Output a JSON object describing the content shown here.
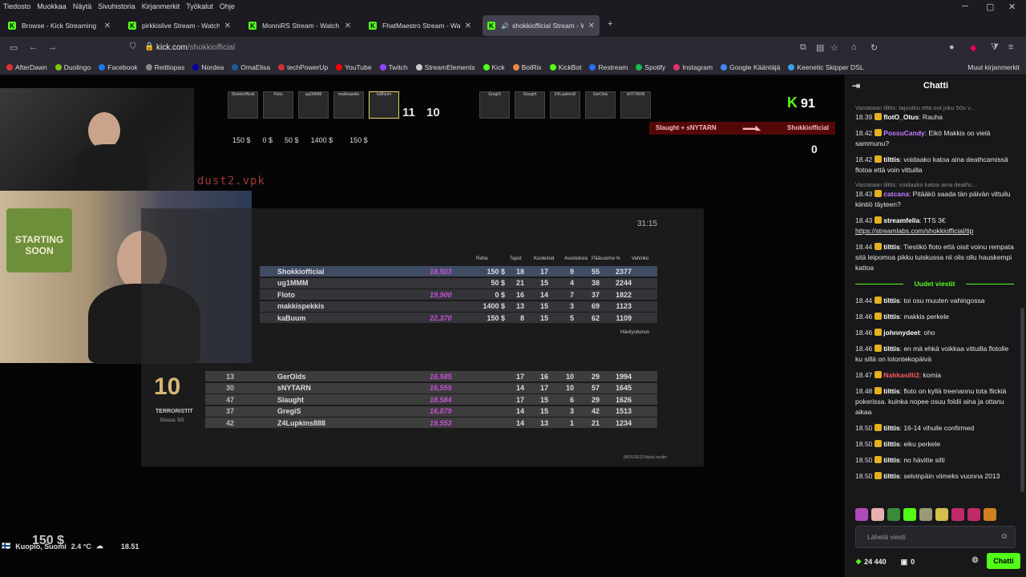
{
  "menu": [
    "Tiedosto",
    "Muokkaa",
    "Näytä",
    "Sivuhistoria",
    "Kirjanmerkit",
    "Työkalut",
    "Ohje"
  ],
  "tabs": [
    {
      "label": "Browse - Kick Streaming"
    },
    {
      "label": "pirkkislive Stream - Watch Li"
    },
    {
      "label": "MonniRS Stream - Watch Li"
    },
    {
      "label": "FhatMaestro Stream - Watch"
    },
    {
      "label": "shokkiofficial Stream - Watc"
    }
  ],
  "address": {
    "domain": "kick.com",
    "path": "/shokkiofficial"
  },
  "bookmarks": [
    {
      "label": "AfterDawn",
      "color": "#d33"
    },
    {
      "label": "Duolingo",
      "color": "#7ac70c"
    },
    {
      "label": "Facebook",
      "color": "#1877f2"
    },
    {
      "label": "Reittiopas",
      "color": "#888"
    },
    {
      "label": "Nordea",
      "color": "#0000a0"
    },
    {
      "label": "OmaElisa",
      "color": "#1e5aa0"
    },
    {
      "label": "techPowerUp",
      "color": "#c33"
    },
    {
      "label": "YouTube",
      "color": "#f00"
    },
    {
      "label": "Twitch",
      "color": "#9146ff"
    },
    {
      "label": "StreamElements",
      "color": "#ccc"
    },
    {
      "label": "Kick",
      "color": "#53fc18"
    },
    {
      "label": "BotRix",
      "color": "#e84"
    },
    {
      "label": "KickBot",
      "color": "#53fc18"
    },
    {
      "label": "Restream",
      "color": "#2b6cf6"
    },
    {
      "label": "Spotify",
      "color": "#1db954"
    },
    {
      "label": "Instagram",
      "color": "#e1306c"
    },
    {
      "label": "Google Kääntäjä",
      "color": "#4285f4"
    },
    {
      "label": "Keenetic Skipper DSL",
      "color": "#3aa3e3"
    }
  ],
  "bookmarks_other": "Muut kirjanmerkit",
  "game": {
    "top_players": [
      "Shokkiofficial",
      "Floto",
      "ug1MMM",
      "makkispekk",
      "kaBuum",
      "GregiS",
      "Slaught",
      "Z4LupkinsR",
      "GerOlds",
      "sNYTARN"
    ],
    "score_left": "11",
    "score_right": "10",
    "money_row": [
      "150 $",
      "0 $",
      "50 $",
      "1400 $",
      "150 $"
    ],
    "k_score": "91",
    "killfeed_left": "Slaught + sNYTARN",
    "killfeed_right": "Shokkiofficial",
    "zero": "0",
    "map": "dust2.vpk",
    "timer": "31:15",
    "headers": [
      "Raha",
      "Tapot",
      "Kuolemat",
      "Avustuksia",
      "Pääsuoma %",
      "Vahinko"
    ],
    "ct_rows": [
      {
        "name": "Shokkiofficial",
        "cash": "18,503",
        "money": "150 $",
        "k": "18",
        "d": "17",
        "a": "9",
        "hs": "55",
        "dmg": "2377"
      },
      {
        "name": "ug1MMM",
        "cash": "",
        "money": "50 $",
        "k": "21",
        "d": "15",
        "a": "4",
        "hs": "38",
        "dmg": "2244"
      },
      {
        "name": "Floto",
        "cash": "19,900",
        "money": "0 $",
        "k": "16",
        "d": "14",
        "a": "7",
        "hs": "37",
        "dmg": "1822"
      },
      {
        "name": "makkispekkis",
        "cash": "",
        "money": "1400 $",
        "k": "13",
        "d": "15",
        "a": "3",
        "hs": "69",
        "dmg": "1123"
      },
      {
        "name": "kaBuum",
        "cash": "22,370",
        "money": "150 $",
        "k": "8",
        "d": "15",
        "a": "5",
        "hs": "62",
        "dmg": "1109"
      }
    ],
    "hävitysbonus": "Hävitysbonus",
    "t_score": "10",
    "t_label": "TERRORISTIT",
    "t_alive": "Elossa: 5/5",
    "t_rows": [
      {
        "num": "13",
        "name": "GerOlds",
        "cash": "16,585",
        "k": "17",
        "d": "16",
        "a": "10",
        "hs": "29",
        "dmg": "1994"
      },
      {
        "num": "30",
        "name": "sNYTARN",
        "cash": "16,555",
        "k": "14",
        "d": "17",
        "a": "10",
        "hs": "57",
        "dmg": "1645"
      },
      {
        "num": "47",
        "name": "Slaught",
        "cash": "18,584",
        "k": "17",
        "d": "15",
        "a": "6",
        "hs": "29",
        "dmg": "1626"
      },
      {
        "num": "37",
        "name": "GregiS",
        "cash": "16,879",
        "k": "14",
        "d": "15",
        "a": "3",
        "hs": "42",
        "dmg": "1513"
      },
      {
        "num": "42",
        "name": "Z4Lupkins888",
        "cash": "19,553",
        "k": "14",
        "d": "13",
        "a": "1",
        "hs": "21",
        "dmg": "1234"
      }
    ],
    "footnote": "[MOUSE2] Näytä osoitin",
    "poster": "STARTING SOON",
    "bottom_money": "150 $"
  },
  "weather": {
    "location": "Kuopio, Suomi",
    "temp": "2.4 °C",
    "time": "18.51"
  },
  "chat": {
    "title": "Chatti",
    "messages": [
      {
        "reply": "Vastataan tilttis: tajuutko että oot joku 50v v...",
        "time": "18.39",
        "user": "flotO_Otus",
        "color": "#ffffff",
        "text": ": Rauha"
      },
      {
        "time": "18.42",
        "user": "PossuCandy",
        "color": "#c77dff",
        "text": ": Eikö Makkis oo vielä sammunu?"
      },
      {
        "time": "18.42",
        "user": "tilttis",
        "color": "#ffffff",
        "text": ": voidaako katoa aina deathcamissä flotoa että voin vittuilla"
      },
      {
        "reply": "Vastataan tilttis: voidaako katoa aina deathc...",
        "time": "18.43",
        "user": "catcana",
        "color": "#c77dff",
        "text": ": Pitääkö saada tän päivän vittuilu kiintiö täyteen?"
      },
      {
        "time": "18.43",
        "user": "streamfella",
        "color": "#ffffff",
        "text": ": TTS 3€ ",
        "link": "https://streamlabs.com/shokkiofficial/tip"
      },
      {
        "time": "18.44",
        "user": "tilttis",
        "color": "#ffffff",
        "text": ": Tiestikö floto että oisit voinu rempata sitä leipomoa pikku tuiskussa nii olis ollu hauskempi kattoa"
      }
    ],
    "divider": "Uudet viestit",
    "new_messages": [
      {
        "time": "18.44",
        "user": "tilttis",
        "color": "#ffffff",
        "text": ": toi osu muuten vahingossa"
      },
      {
        "time": "18.46",
        "user": "tilttis",
        "color": "#ffffff",
        "text": ": makkis perkele"
      },
      {
        "time": "18.46",
        "user": "johnnydeet",
        "color": "#ffffff",
        "text": ": oho"
      },
      {
        "time": "18.46",
        "user": "tilttis",
        "color": "#ffffff",
        "text": ": en mä ehkä voikkaa vittuilla flotolle ku sillä on lotontekopäivä"
      },
      {
        "time": "18.47",
        "user": "Nahkasilli2",
        "color": "#ff5a5a",
        "text": ": komia"
      },
      {
        "time": "18.48",
        "user": "tilttis",
        "color": "#ffffff",
        "text": ": floto on kyllä treenannu tota flickiä pokerissa. kuinka nopee osuu foldii aina ja ottanu aikaa"
      },
      {
        "time": "18.50",
        "user": "tilttis",
        "color": "#ffffff",
        "text": ": 16-14 vihulle confirmed"
      },
      {
        "time": "18.50",
        "user": "tilttis",
        "color": "#ffffff",
        "text": ": eiku perkele"
      },
      {
        "time": "18.50",
        "user": "tilttis",
        "color": "#ffffff",
        "text": ": no hävitte silti"
      },
      {
        "time": "18.50",
        "user": "tilttis",
        "color": "#ffffff",
        "text": ": selvinpäin viimeks vuonna 2013"
      }
    ],
    "placeholder": "Lähetä viesti",
    "points": "24 440",
    "gifts": "0",
    "send": "Chatti"
  }
}
